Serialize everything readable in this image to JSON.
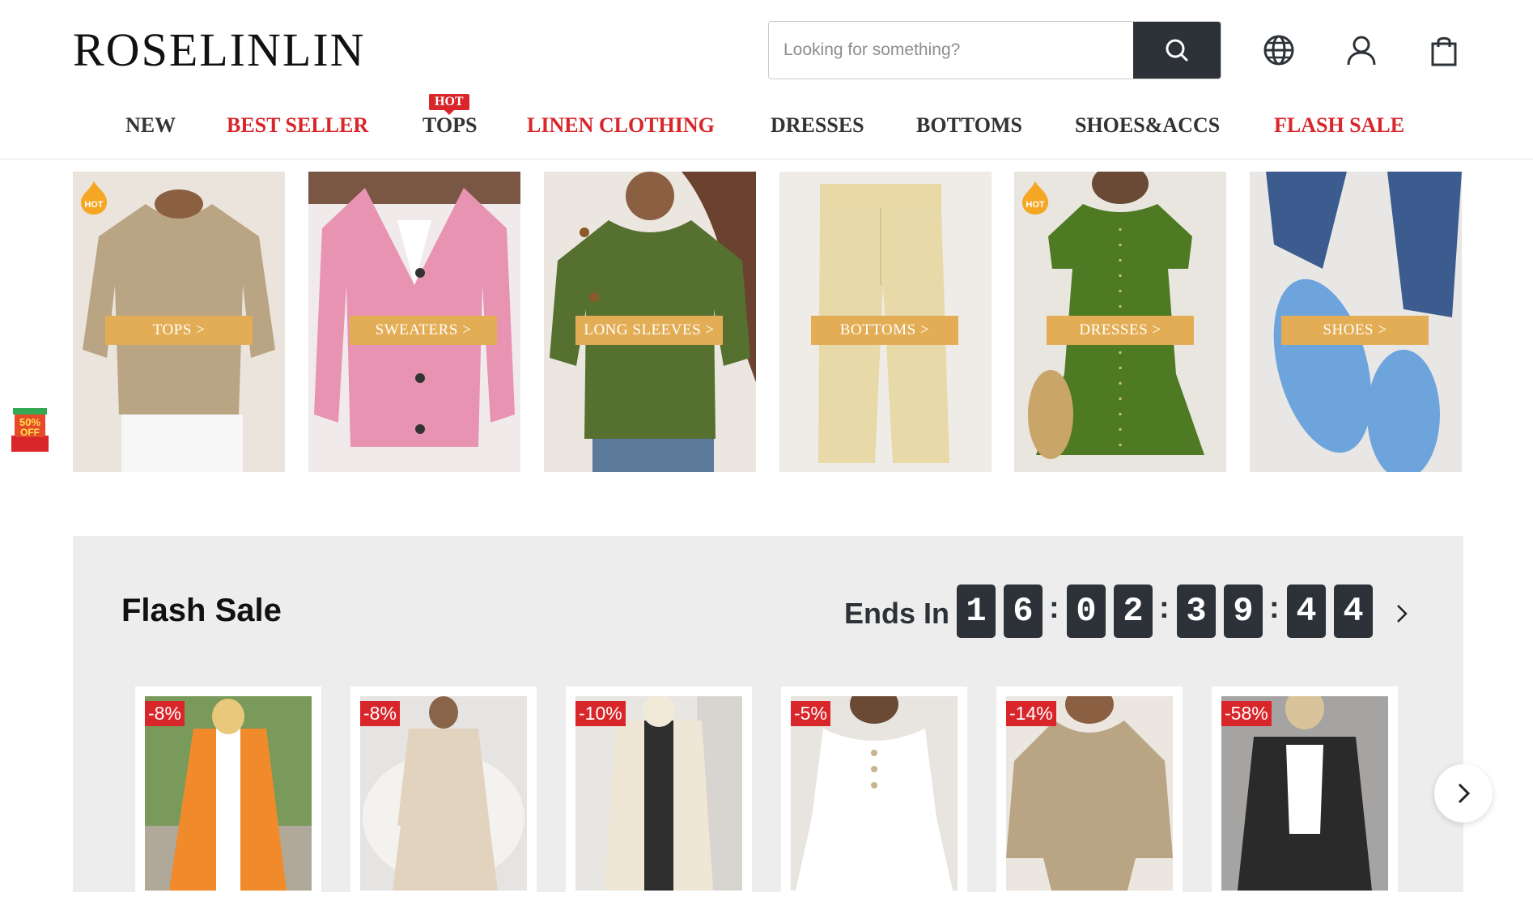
{
  "brand": {
    "logo": "ROSELINLIN"
  },
  "search": {
    "placeholder": "Looking for something?"
  },
  "nav": {
    "hot_label": "HOT",
    "items": [
      {
        "label": "NEW",
        "color": "#333333"
      },
      {
        "label": "BEST SELLER",
        "color": "#d8262b"
      },
      {
        "label": "TOPS",
        "color": "#333333"
      },
      {
        "label": "LINEN CLOTHING",
        "color": "#d8262b"
      },
      {
        "label": "DRESSES",
        "color": "#333333"
      },
      {
        "label": "BOTTOMS",
        "color": "#333333"
      },
      {
        "label": "SHOES&ACCS",
        "color": "#333333"
      },
      {
        "label": "FLASH SALE",
        "color": "#d8262b"
      }
    ]
  },
  "categories": [
    {
      "button": "TOPS >",
      "hot": true,
      "hot_label": "HOT"
    },
    {
      "button": "SWEATERS >",
      "hot": false
    },
    {
      "button": "LONG SLEEVES >",
      "hot": false
    },
    {
      "button": "BOTTOMS >",
      "hot": false
    },
    {
      "button": "DRESSES >",
      "hot": true,
      "hot_label": "HOT"
    },
    {
      "button": "SHOES >",
      "hot": false
    }
  ],
  "promo": {
    "text_top": "50%",
    "text_bottom": "OFF"
  },
  "flash_sale": {
    "title": "Flash Sale",
    "ends_in_label": "Ends In",
    "countdown": [
      "1",
      "6",
      "0",
      "2",
      "3",
      "9",
      "4",
      "4"
    ],
    "products": [
      {
        "discount": "-8%"
      },
      {
        "discount": "-8%"
      },
      {
        "discount": "-10%"
      },
      {
        "discount": "-5%"
      },
      {
        "discount": "-14%"
      },
      {
        "discount": "-58%"
      }
    ]
  },
  "colors": {
    "accent_red": "#d8262b",
    "dark": "#2c3238",
    "button_gold": "#e3ad55",
    "flash_bg": "#ededed"
  }
}
